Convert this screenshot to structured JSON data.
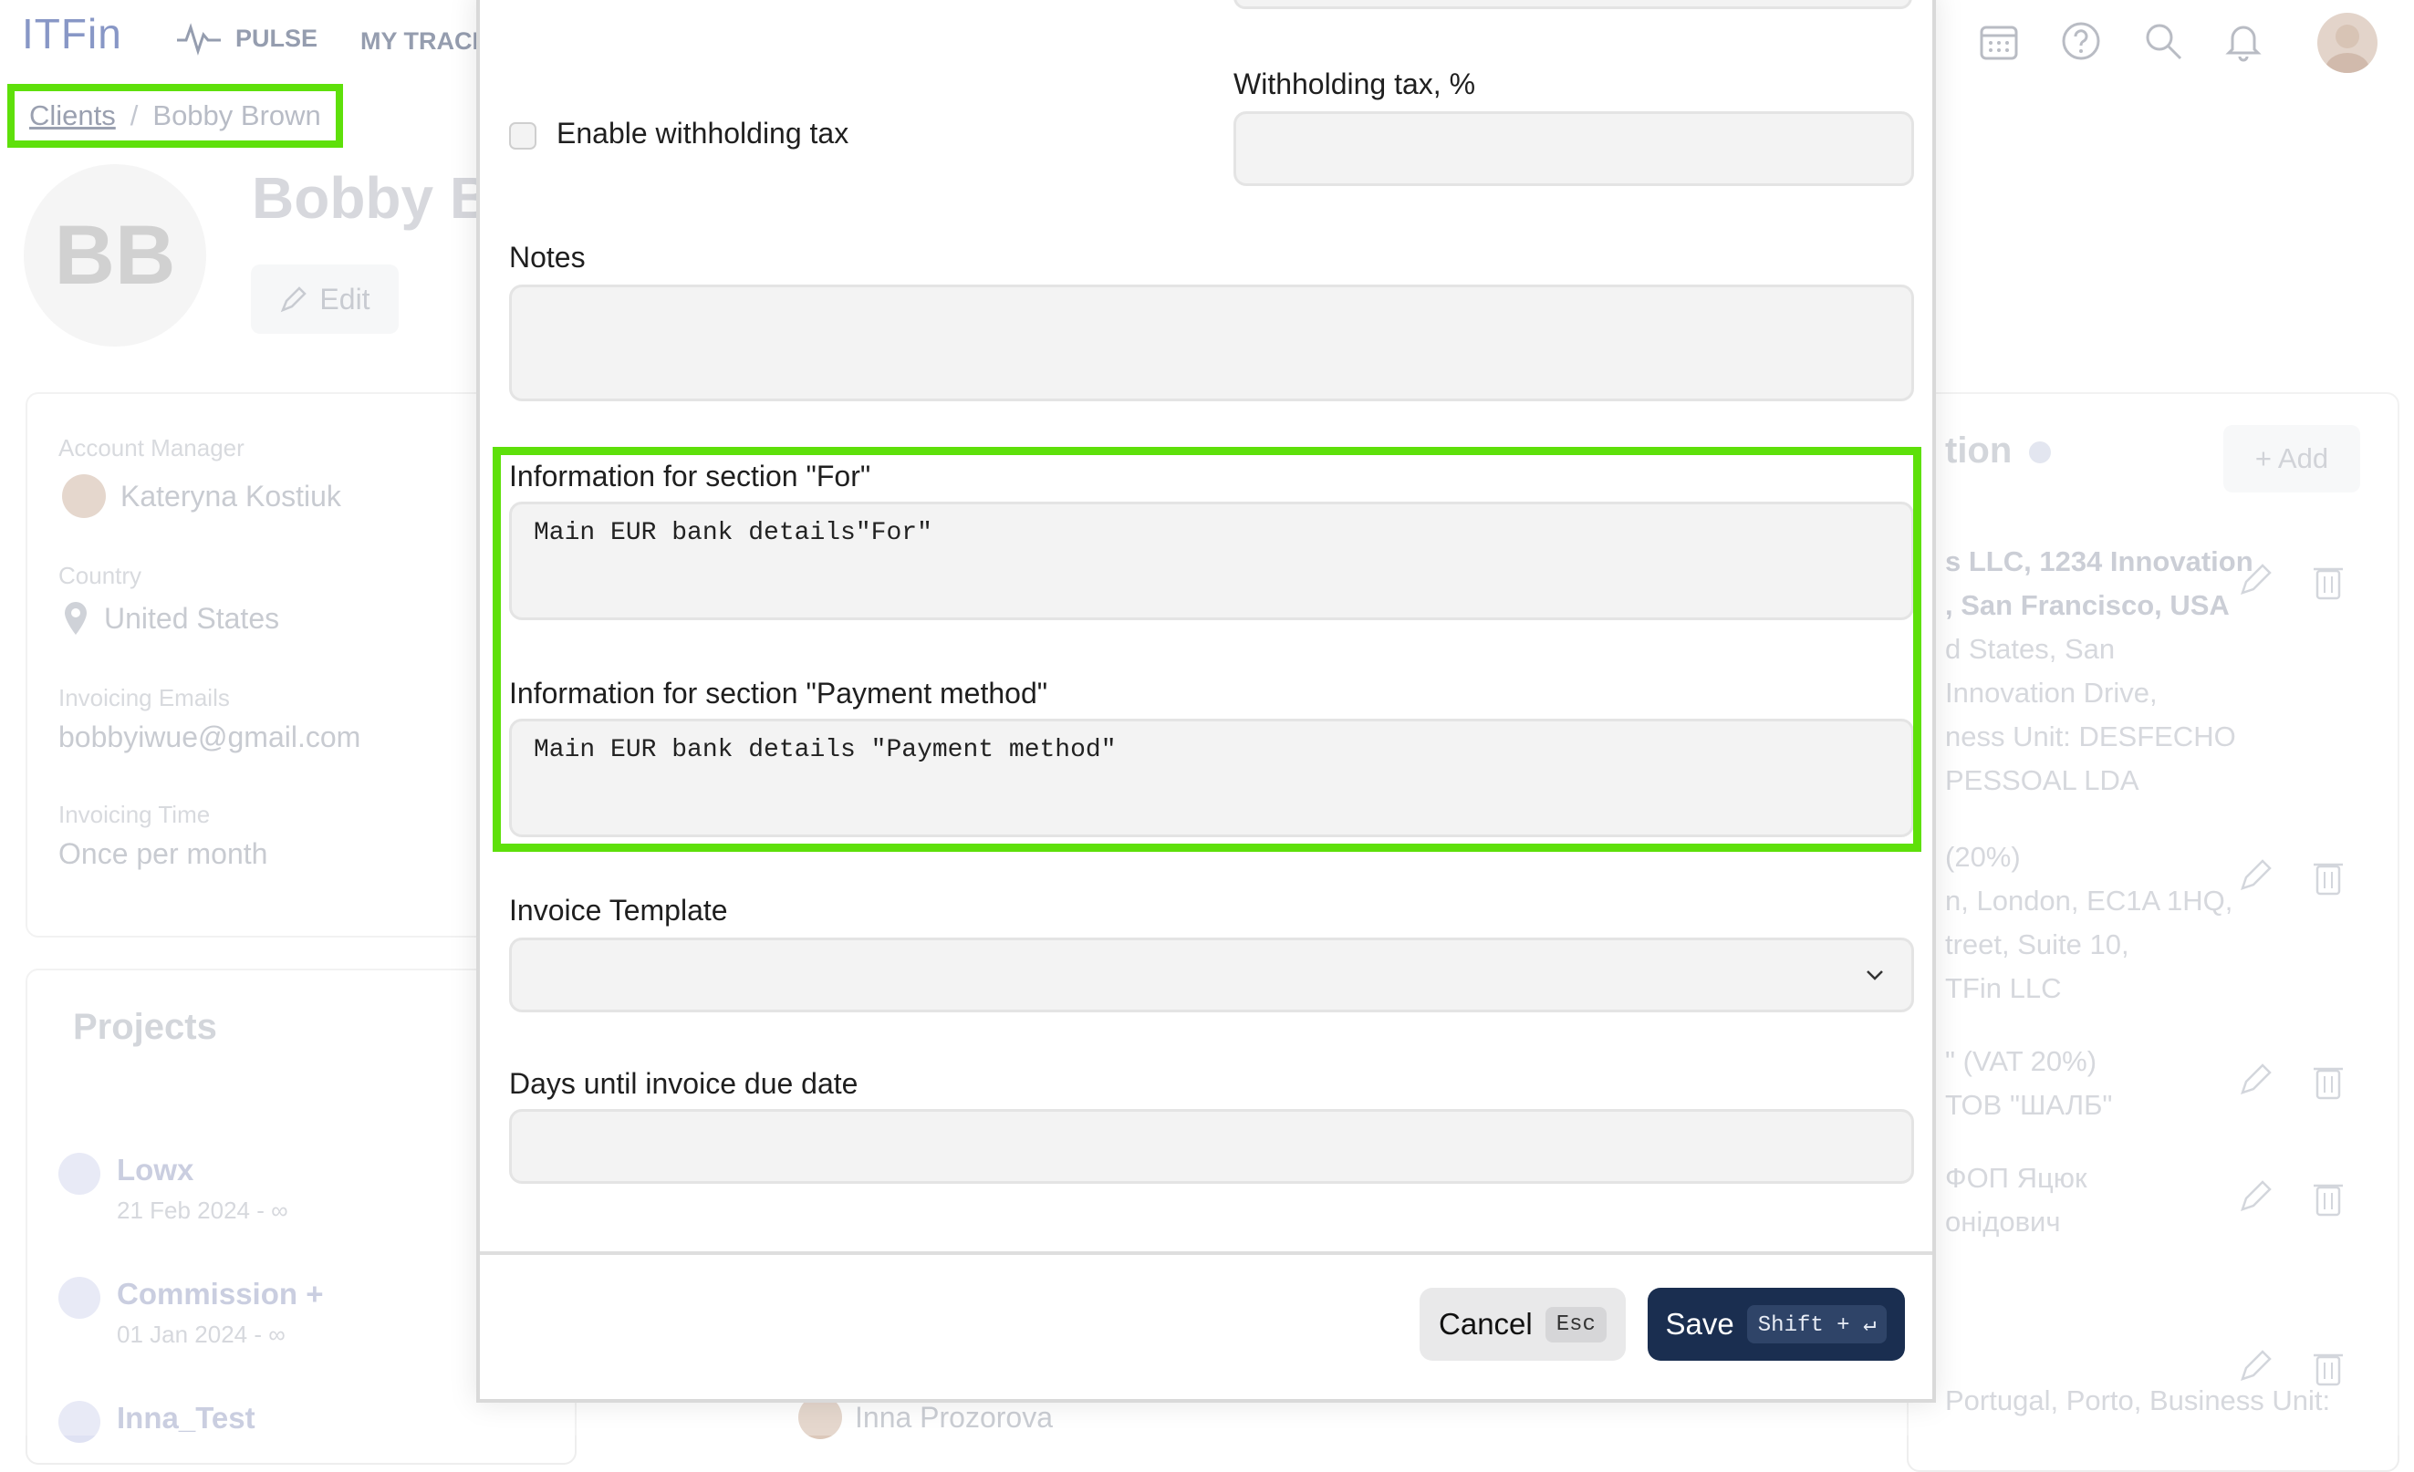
{
  "app": {
    "logo": "ITFin"
  },
  "nav": {
    "pulse": "PULSE",
    "my_tracker": "MY TRACKE"
  },
  "topbar_icons": [
    "calendar-icon",
    "help-icon",
    "search-icon",
    "bell-icon"
  ],
  "breadcrumb": {
    "clients": "Clients",
    "separator": "/",
    "current": "Bobby Brown"
  },
  "client": {
    "initials": "BB",
    "name": "Bobby Br",
    "edit_label": "Edit"
  },
  "details": {
    "account_manager_label": "Account Manager",
    "account_manager": "Kateryna Kostiuk",
    "country_label": "Country",
    "country": "United States",
    "emails_label": "Invoicing Emails",
    "email": "bobbyiwue@gmail.com",
    "time_label": "Invoicing Time",
    "time": "Once per month"
  },
  "projects": {
    "title": "Projects",
    "items": [
      {
        "name": "Lowx",
        "dates": "21 Feb 2024 - ∞"
      },
      {
        "name": "Commission +",
        "dates": "01 Jan 2024 - ∞"
      },
      {
        "name": "Inna_Test",
        "dates": ""
      }
    ]
  },
  "right_panel": {
    "title": "tion",
    "add_label": "+ Add",
    "entries": [
      {
        "lines": [
          "s LLC, 1234 Innovation",
          ", San Francisco, USA",
          "d States, San",
          "Innovation Drive,",
          "ness Unit: DESFECHO",
          "PESSOAL LDA"
        ]
      },
      {
        "lines": [
          "(20%)",
          "n, London, EC1A 1HQ,",
          "treet, Suite 10,",
          "TFin LLC"
        ]
      },
      {
        "lines": [
          "\" (VAT 20%)",
          "ТОВ \"ШАЛБ\""
        ]
      },
      {
        "lines": [
          "ФОП Яцюк",
          "онідович"
        ]
      },
      {
        "lines": [
          "Portugal, Porto, Business Unit:"
        ]
      }
    ]
  },
  "bottom_user": "Inna Prozorova",
  "modal": {
    "withholding_checkbox_label": "Enable withholding tax",
    "withholding_tax_label": "Withholding tax, %",
    "withholding_tax_value": "",
    "notes_label": "Notes",
    "notes_value": "",
    "for_label": "Information for section \"For\"",
    "for_value": "Main EUR bank details\"For\"",
    "payment_label": "Information for section \"Payment method\"",
    "payment_value": "Main EUR bank details \"Payment method\"",
    "template_label": "Invoice Template",
    "template_value": "",
    "due_label": "Days until invoice due date",
    "due_value": "",
    "cancel_label": "Cancel",
    "cancel_key": "Esc",
    "save_label": "Save",
    "save_key": "Shift + ↵"
  }
}
